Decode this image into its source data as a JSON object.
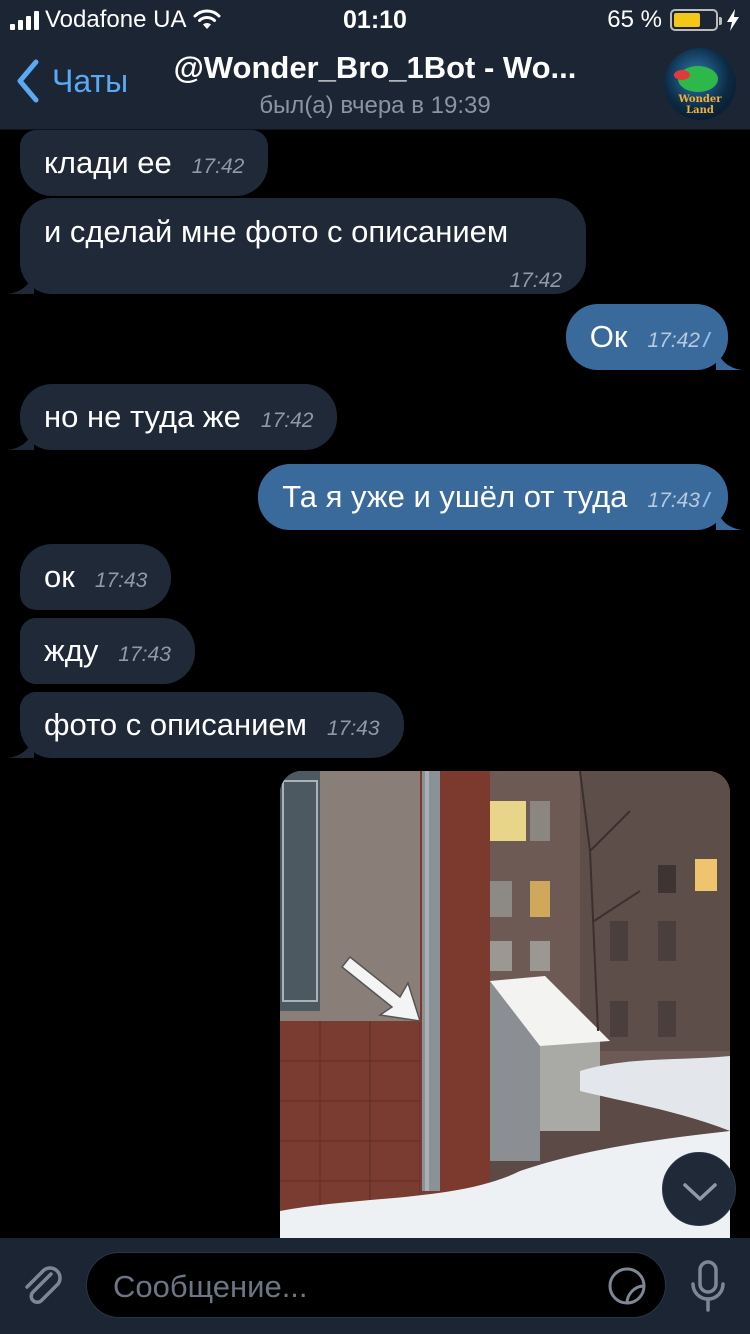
{
  "status_bar": {
    "carrier": "Vodafone UA",
    "time": "01:10",
    "battery_percent": "65 %",
    "battery_level": 0.65
  },
  "header": {
    "back_label": "Чаты",
    "title": "@Wonder_Bro_1Bot - Wo...",
    "subtitle": "был(а) вчера в 19:39",
    "avatar_text": "Wonder Land"
  },
  "messages": [
    {
      "direction": "incoming",
      "text": "клади ее",
      "time": "17:42"
    },
    {
      "direction": "incoming",
      "text": "и сделай мне фото с описанием",
      "time": "17:42"
    },
    {
      "direction": "outgoing",
      "text": "Ок",
      "time": "17:42",
      "status": "read"
    },
    {
      "direction": "incoming",
      "text": "но не туда же",
      "time": "17:42"
    },
    {
      "direction": "outgoing",
      "text": "Та я уже и ушёл от туда",
      "time": "17:43",
      "status": "read"
    },
    {
      "direction": "incoming",
      "text": "ок",
      "time": "17:43"
    },
    {
      "direction": "incoming",
      "text": "жду",
      "time": "17:43"
    },
    {
      "direction": "incoming",
      "text": "фото с описанием",
      "time": "17:43"
    },
    {
      "direction": "outgoing",
      "type": "photo",
      "text": "",
      "time": ""
    }
  ],
  "input": {
    "placeholder": "Сообщение..."
  },
  "icons": {
    "back": "chevron-left-icon",
    "attach": "paperclip-icon",
    "sticker": "sticker-icon",
    "mic": "microphone-icon",
    "scroll": "chevron-down-icon",
    "read": "double-check-icon"
  },
  "colors": {
    "accent": "#5aa9f5",
    "bubble_incoming": "#1f2937",
    "bubble_outgoing": "#3a6a9b",
    "bar_background": "#1c2533"
  }
}
